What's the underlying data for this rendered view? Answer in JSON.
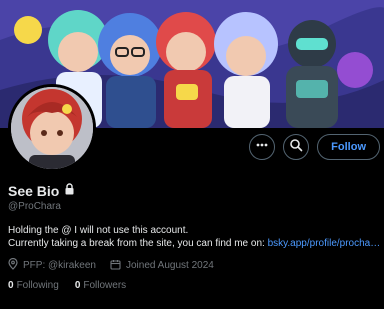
{
  "profile": {
    "display_name": "See Bio",
    "handle": "@ProChara",
    "bio_line1": "Holding the @ I will not use this account.",
    "bio_line2_text": "Currently taking a break from the site, you can find me on: ",
    "bio_line2_link": "bsky.app/profile/procha…",
    "pfp_credit": "PFP: @kirakeen",
    "joined": "Joined August 2024",
    "following_count": "0",
    "following_label": "Following",
    "followers_count": "0",
    "followers_label": "Followers"
  },
  "actions": {
    "follow_label": "Follow"
  },
  "icons": {
    "more": "more-icon",
    "search": "search-icon",
    "lock": "lock-icon",
    "location": "location-icon",
    "calendar": "calendar-icon"
  },
  "colors": {
    "accent": "#4c9aff",
    "muted": "#71767b",
    "text": "#e7e9ea",
    "background": "#000000"
  }
}
